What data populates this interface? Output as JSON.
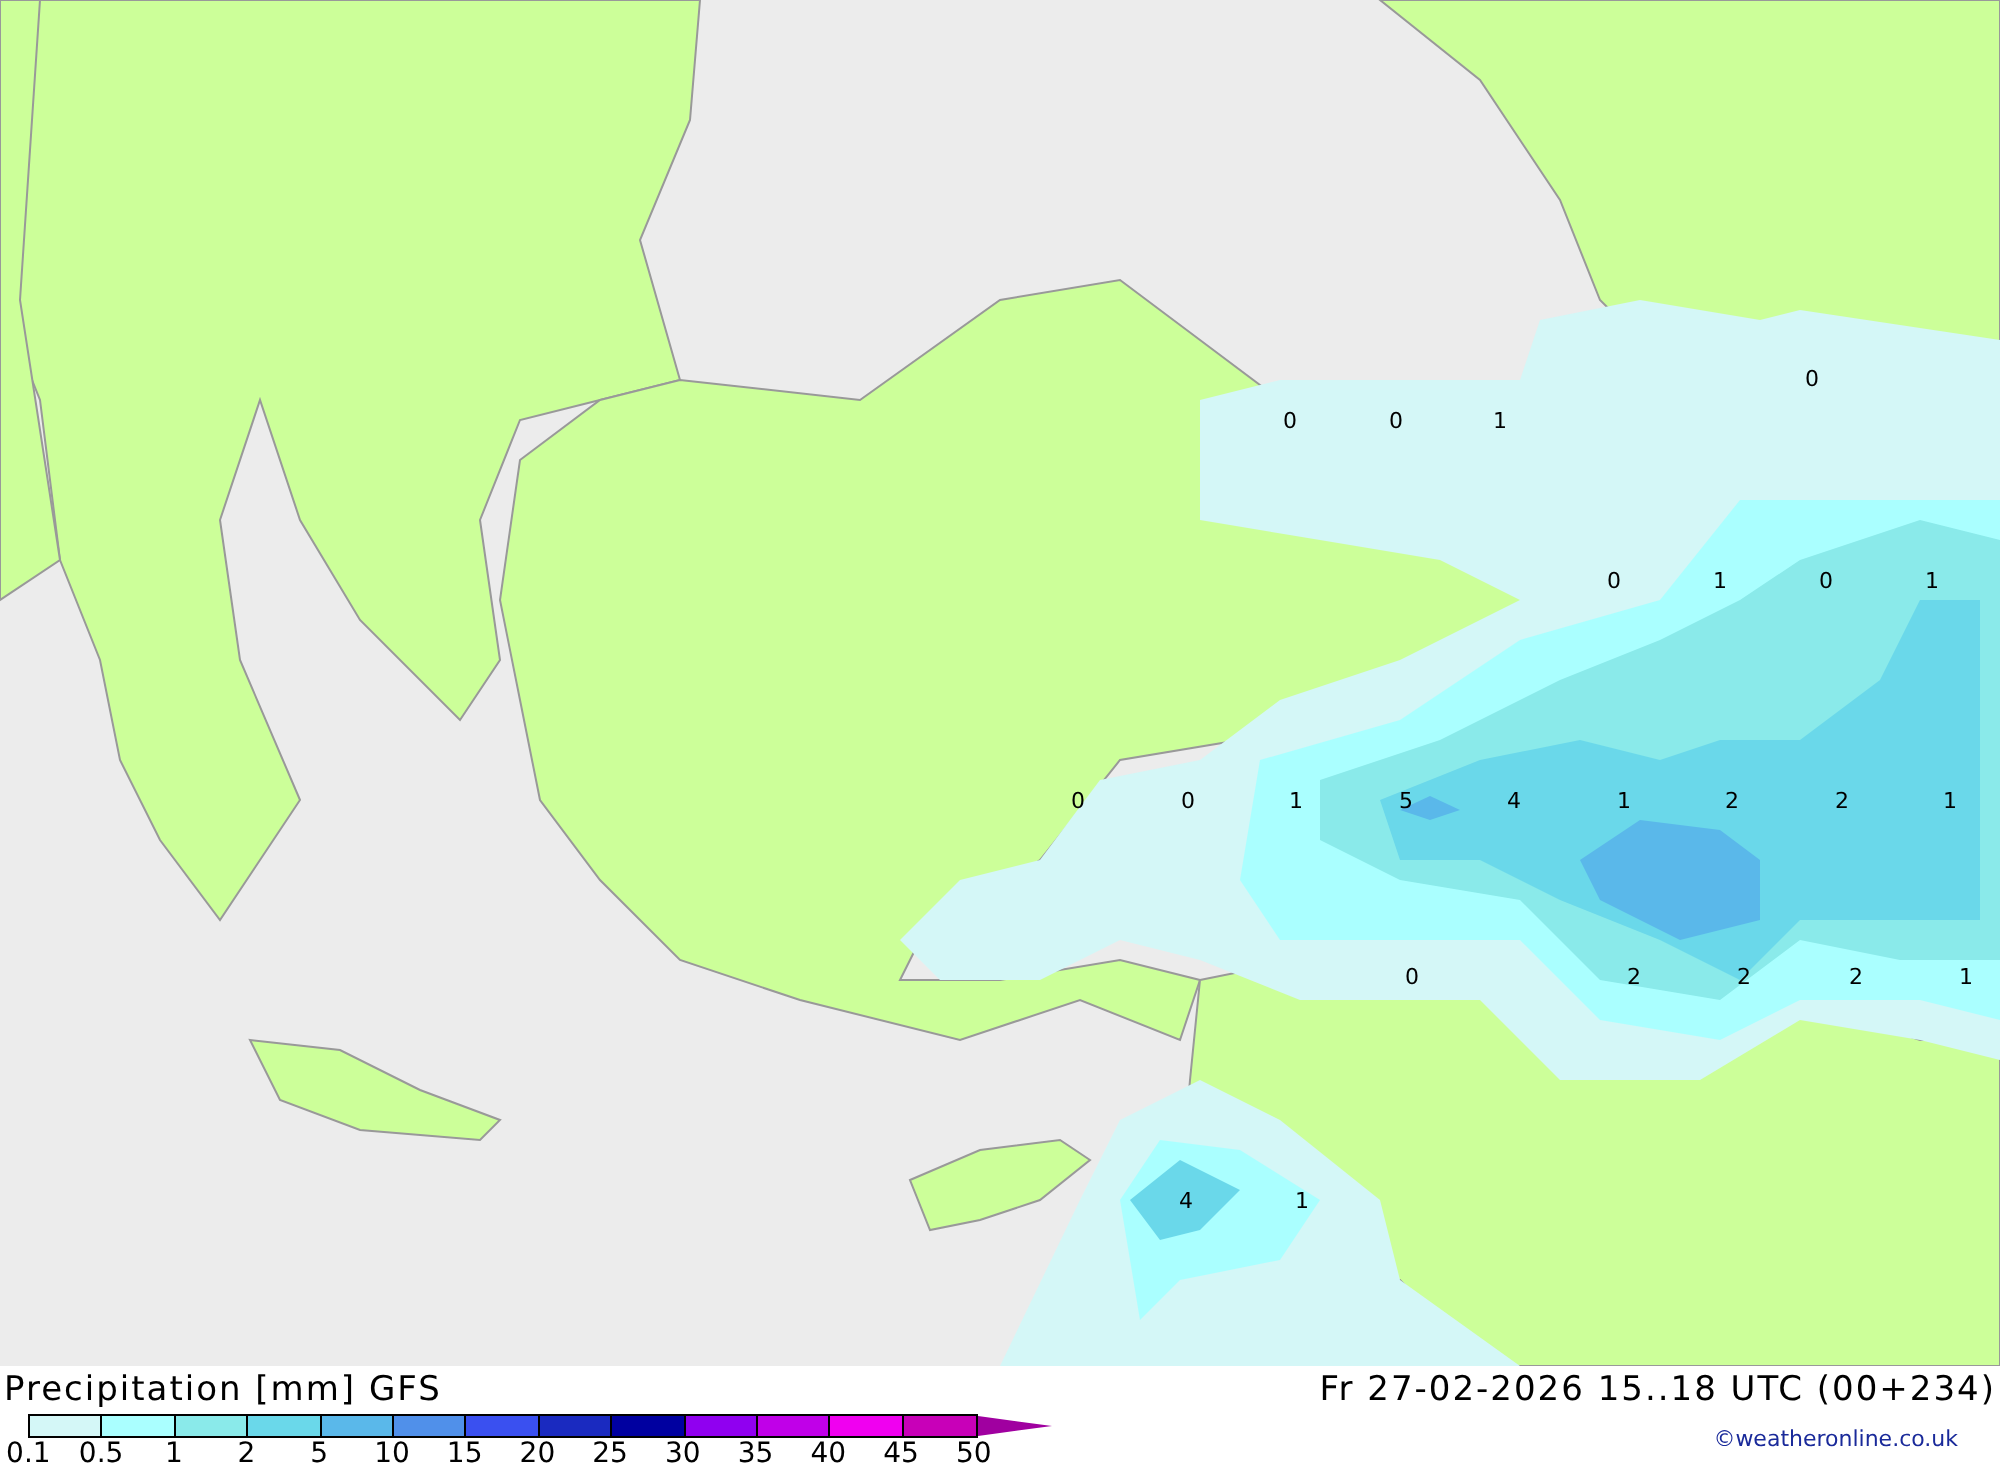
{
  "map": {
    "contour_labels": [
      "0",
      "0",
      "0",
      "1",
      "0",
      "1",
      "0",
      "1",
      "0",
      "0",
      "1",
      "5",
      "4",
      "1",
      "2",
      "2",
      "1",
      "0",
      "2",
      "2",
      "2",
      "1",
      "4",
      "1"
    ]
  },
  "footer": {
    "title": "Precipitation [mm] GFS",
    "valid_time": "Fr 27-02-2026 15..18 UTC (00+234)",
    "credit": "©weatheronline.co.uk",
    "legend": {
      "bins": [
        {
          "color": "#d4f7f7"
        },
        {
          "color": "#aaffff"
        },
        {
          "color": "#8aeaea"
        },
        {
          "color": "#6ad8ea"
        },
        {
          "color": "#5ab8ea"
        },
        {
          "color": "#5090ea"
        },
        {
          "color": "#3a50f0"
        },
        {
          "color": "#1a2ac0"
        },
        {
          "color": "#0000a0"
        },
        {
          "color": "#9000f0"
        },
        {
          "color": "#c000e8"
        },
        {
          "color": "#f000f0"
        },
        {
          "color": "#c800b8"
        }
      ],
      "overflow": {
        "color": "#a000a0"
      },
      "ticks": [
        "0.1",
        "0.5",
        "1",
        "2",
        "5",
        "10",
        "15",
        "20",
        "25",
        "30",
        "35",
        "40",
        "45",
        "50"
      ]
    }
  }
}
